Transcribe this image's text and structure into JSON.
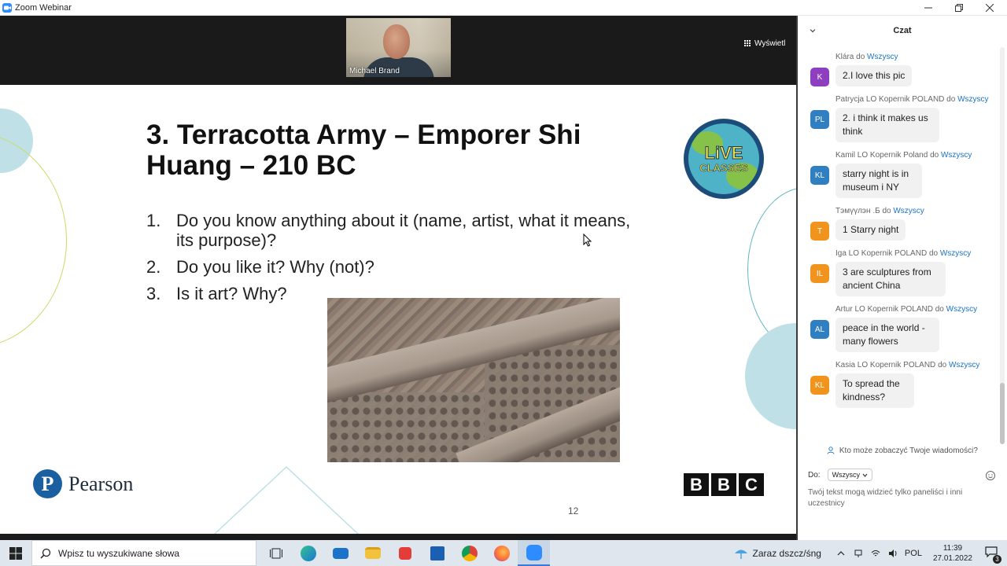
{
  "window": {
    "title": "Zoom Webinar"
  },
  "video": {
    "speaker_name": "Michael Brand",
    "view_button": "Wyświetl"
  },
  "slide": {
    "title": "3. Terracotta Army – Emporer Shi Huang – 210 BC",
    "questions": [
      {
        "num": "1.",
        "text": "Do you know anything about it (name, artist, what it means, its purpose)?"
      },
      {
        "num": "2.",
        "text": "Do you like it? Why (not)?"
      },
      {
        "num": "3.",
        "text": "Is it art? Why?"
      }
    ],
    "page_number": "12",
    "logo_live_line1": "LiVE",
    "logo_live_line2": "CLASSES",
    "pearson": "Pearson",
    "pearson_mark": "P",
    "bbc": [
      "B",
      "B",
      "C"
    ]
  },
  "chat": {
    "title": "Czat",
    "messages": [
      {
        "sender": "Klára",
        "to_word": "do",
        "to": "Wszyscy",
        "text": "2.I love this pic",
        "initials": "K",
        "color": "#8e3fbf"
      },
      {
        "sender": "Patrycja LO Kopernik POLAND",
        "to_word": "do",
        "to": "Wszyscy",
        "text": "2. i think it makes us think",
        "initials": "PL",
        "color": "#2f7fc1"
      },
      {
        "sender": "Kamil LO Kopernik Poland",
        "to_word": "do",
        "to": "Wszyscy",
        "text": "starry night is in museum i NY",
        "initials": "KL",
        "color": "#2f7fc1"
      },
      {
        "sender": "Тэмүүлэн .Б",
        "to_word": "do",
        "to": "Wszyscy",
        "text": "1 Starry night",
        "initials": "T",
        "color": "#f0941e"
      },
      {
        "sender": "Iga LO Kopernik POLAND",
        "to_word": "do",
        "to": "Wszyscy",
        "text": "3 are sculptures from ancient China",
        "initials": "IL",
        "color": "#f0941e"
      },
      {
        "sender": "Artur LO Kopernik POLAND",
        "to_word": "do",
        "to": "Wszyscy",
        "text": "peace in the world - many flowers",
        "initials": "AL",
        "color": "#2f7fc1"
      },
      {
        "sender": "Kasia LO Kopernik POLAND",
        "to_word": "do",
        "to": "Wszyscy",
        "text": "To spread the kindness?",
        "initials": "KL",
        "color": "#f0941e"
      }
    ],
    "who_can_see": "Kto może zobaczyć Twoje wiadomości?",
    "to_label": "Do:",
    "to_value": "Wszyscy",
    "hint": "Twój tekst mogą widzieć tylko paneliści i inni uczestnicy"
  },
  "taskbar": {
    "search_placeholder": "Wpisz tu wyszukiwane słowa",
    "weather": "Zaraz dszcz/śng",
    "language": "POL",
    "time": "11:39",
    "date": "27.01.2022",
    "notifications": "3"
  }
}
